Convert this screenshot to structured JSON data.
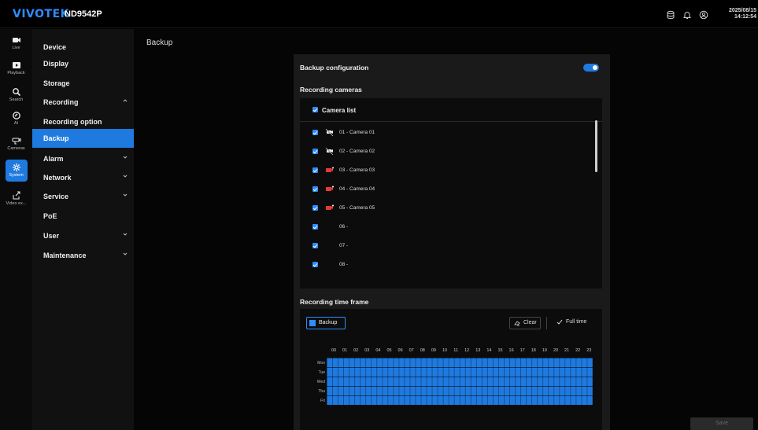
{
  "header": {
    "logo": "VIVOTEK",
    "model": "ND9542P",
    "date": "2025/08/15",
    "time": "14:12:54",
    "icons": [
      "database-icon",
      "bell-icon",
      "user-circle-icon"
    ]
  },
  "rail": [
    {
      "label": "Live",
      "icon": "video-camera-icon"
    },
    {
      "label": "Playback",
      "icon": "play-icon"
    },
    {
      "label": "Search",
      "icon": "search-icon"
    },
    {
      "label": "AI",
      "icon": "ai-icon"
    },
    {
      "label": "Cameras",
      "icon": "cctv-camera-icon"
    },
    {
      "label": "System",
      "icon": "gear-icon",
      "active": true
    },
    {
      "label": "Video ex...",
      "icon": "export-icon"
    }
  ],
  "menu": [
    {
      "label": "Device"
    },
    {
      "label": "Display"
    },
    {
      "label": "Storage"
    },
    {
      "label": "Recording",
      "expanded": true
    },
    {
      "label": "Recording option"
    },
    {
      "label": "Backup",
      "selected": true
    },
    {
      "label": "Alarm",
      "collapsible": true
    },
    {
      "label": "Network",
      "collapsible": true
    },
    {
      "label": "Service",
      "collapsible": true
    },
    {
      "label": "PoE"
    },
    {
      "label": "User",
      "collapsible": true
    },
    {
      "label": "Maintenance",
      "collapsible": true
    }
  ],
  "page": {
    "title": "Backup",
    "backup_config_label": "Backup configuration",
    "backup_enabled": true,
    "recording_cameras_label": "Recording cameras",
    "camera_list_label": "Camera list",
    "cameras": [
      {
        "label": "01 - Camera 01",
        "checked": true,
        "status": "offline"
      },
      {
        "label": "02 - Camera 02",
        "checked": true,
        "status": "offline"
      },
      {
        "label": "03 - Camera 03",
        "checked": true,
        "status": "recording"
      },
      {
        "label": "04 - Camera 04",
        "checked": true,
        "status": "recording"
      },
      {
        "label": "05 - Camera 05",
        "checked": true,
        "status": "recording"
      },
      {
        "label": "06 -",
        "checked": true,
        "status": "none"
      },
      {
        "label": "07 -",
        "checked": true,
        "status": "none"
      },
      {
        "label": "08 -",
        "checked": true,
        "status": "none"
      }
    ],
    "time_frame_label": "Recording time frame",
    "backup_button": "Backup",
    "clear_button": "Clear",
    "full_time_button": "Full time",
    "hours": [
      "00",
      "01",
      "02",
      "03",
      "04",
      "05",
      "06",
      "07",
      "08",
      "09",
      "10",
      "11",
      "12",
      "13",
      "14",
      "15",
      "16",
      "17",
      "18",
      "19",
      "20",
      "21",
      "22",
      "23"
    ],
    "days": [
      "Mon",
      "Tue",
      "Wed",
      "Thu",
      "Fri"
    ],
    "save_button": "Save"
  },
  "colors": {
    "accent": "#1f7ae0",
    "recording": "#e53935"
  }
}
